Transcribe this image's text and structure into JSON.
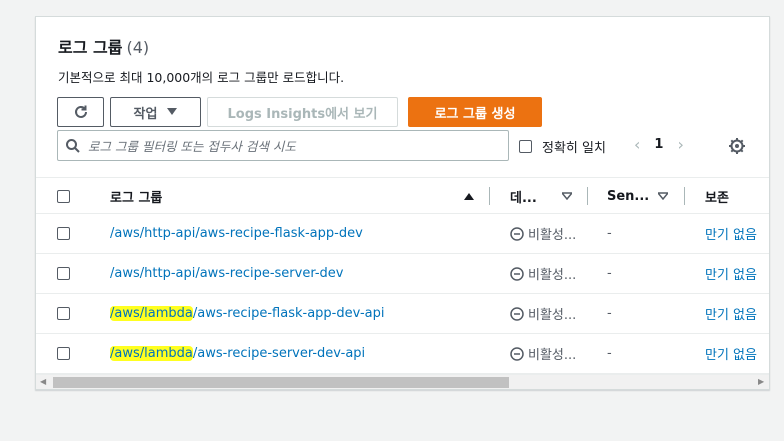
{
  "header": {
    "title": "로그 그룹",
    "count": "(4)",
    "description": "기본적으로 최대 10,000개의 로그 그룹만 로드합니다."
  },
  "toolbar": {
    "refresh_icon": "refresh-icon",
    "actions_label": "작업",
    "insights_label": "Logs Insights에서 보기",
    "create_label": "로그 그룹 생성"
  },
  "filter": {
    "placeholder": "로그 그룹 필터링 또는 접두사 검색 시도",
    "exact_label": "정확히 일치",
    "page": "1"
  },
  "table": {
    "columns": {
      "name": "로그 그룹",
      "data": "데...",
      "sensitive": "Sen...",
      "retention": "보존"
    },
    "rows": [
      {
        "prefix": "",
        "name": "/aws/http-api/aws-recipe-flask-app-dev",
        "status": "비활성...",
        "sensitive": "-",
        "retention": "만기 없음"
      },
      {
        "prefix": "",
        "name": "/aws/http-api/aws-recipe-server-dev",
        "status": "비활성...",
        "sensitive": "-",
        "retention": "만기 없음"
      },
      {
        "prefix": "/aws/lambda",
        "name": "/aws-recipe-flask-app-dev-api",
        "status": "비활성...",
        "sensitive": "-",
        "retention": "만기 없음"
      },
      {
        "prefix": "/aws/lambda",
        "name": "/aws-recipe-server-dev-api",
        "status": "비활성...",
        "sensitive": "-",
        "retention": "만기 없음"
      }
    ]
  },
  "colors": {
    "primary": "#ec7211",
    "link": "#0073bb",
    "highlight": "#ffff20"
  }
}
